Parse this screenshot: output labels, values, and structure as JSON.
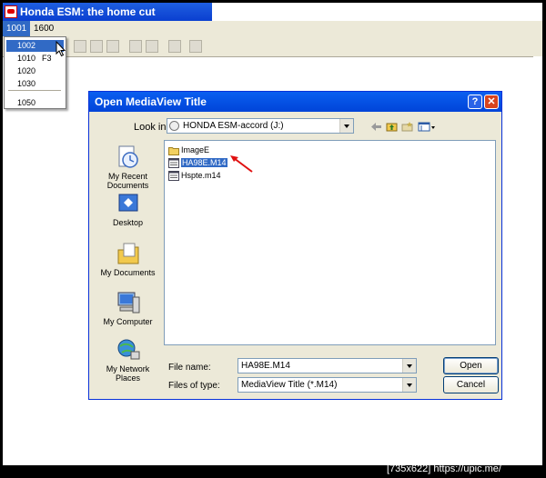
{
  "app": {
    "title": "Honda ESM: the home cut"
  },
  "menubar": {
    "items": [
      "1001",
      "1600"
    ]
  },
  "dropdown": {
    "items": [
      {
        "label": "1002",
        "accel": ""
      },
      {
        "label": "1010",
        "accel": "F3"
      },
      {
        "label": "1020",
        "accel": ""
      },
      {
        "label": "1030",
        "accel": ""
      },
      {
        "label": "1050",
        "accel": ""
      }
    ]
  },
  "dialog": {
    "title": "Open MediaView Title",
    "help_label": "?",
    "close_label": "✕",
    "look_in_label": "Look in:",
    "look_in_value": "HONDA ESM-accord (J:)",
    "places": [
      "My Recent Documents",
      "Desktop",
      "My Documents",
      "My Computer",
      "My Network Places"
    ],
    "files": [
      {
        "name": "ImageE",
        "type": "folder-icon",
        "selected": false
      },
      {
        "name": "HA98E.M14",
        "type": "file-icon",
        "selected": true
      },
      {
        "name": "Hspte.m14",
        "type": "file-icon",
        "selected": false
      }
    ],
    "file_name_label": "File name:",
    "file_name_value": "HA98E.M14",
    "files_of_type_label": "Files of type:",
    "files_of_type_value": "MediaView Title (*.M14)",
    "open_label": "Open",
    "cancel_label": "Cancel"
  },
  "watermark": "[735x622] https://upic.me/",
  "colors": {
    "title_bar": "#0a5ff0",
    "selection": "#316ac5",
    "dialog_bg": "#ece9d8",
    "annotation_arrow": "#e01010"
  }
}
